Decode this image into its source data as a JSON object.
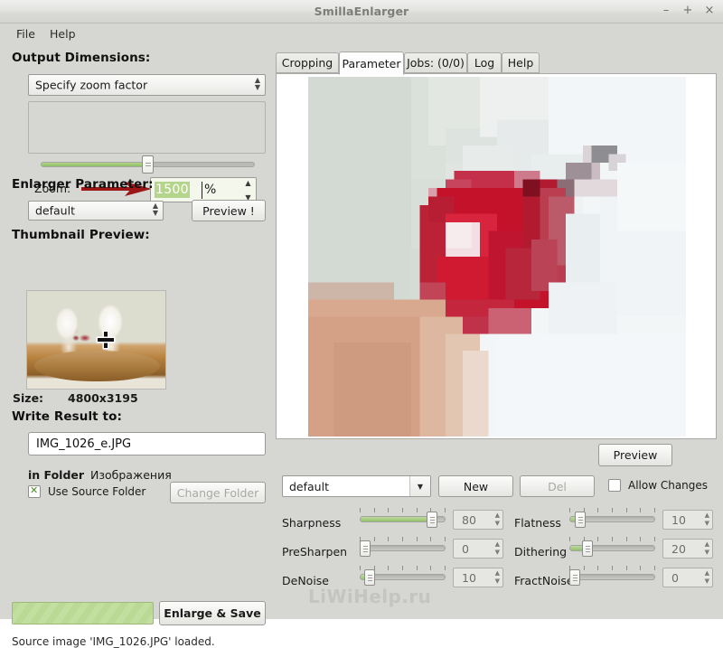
{
  "window": {
    "title": "SmillaEnlarger",
    "buttons": {
      "minimize": "–",
      "maximize": "+",
      "close": "×"
    }
  },
  "menu": {
    "file": "File",
    "help": "Help"
  },
  "left": {
    "output_dimensions_title": "Output Dimensions:",
    "dimension_mode": "Specify zoom factor",
    "zoom_label": "Zoom:",
    "zoom_value": "1500",
    "zoom_unit": "%",
    "zoom_slider_percent": 50,
    "enlarger_parameter_title": "Enlarger Parameter:",
    "enlarger_preset": "default",
    "preview_button": "Preview !",
    "thumbnail_title": "Thumbnail Preview:",
    "size_label": "Size:",
    "size_value": "4800x3195",
    "write_result_title": "Write Result to:",
    "output_filename": "IMG_1026_e.JPG",
    "in_folder_label": "in Folder",
    "in_folder_value": "Изображения",
    "use_source_folder_label": "Use Source Folder",
    "use_source_folder_checked": true,
    "change_folder_button": "Change Folder",
    "enlarge_save_button": "Enlarge & Save",
    "status_text": "Source image 'IMG_1026.JPG' loaded."
  },
  "right": {
    "tabs": [
      {
        "label": "Cropping",
        "active": false
      },
      {
        "label": "Parameter",
        "active": true
      },
      {
        "label": "Jobs: (0/0)",
        "active": false
      },
      {
        "label": "Log",
        "active": false
      },
      {
        "label": "Help",
        "active": false
      }
    ],
    "preview_button": "Preview",
    "preset_combo": "default",
    "new_button": "New",
    "del_button": "Del",
    "allow_changes_label": "Allow Changes",
    "allow_changes_checked": false,
    "parameters": [
      {
        "name": "Sharpness",
        "value": "80",
        "percent": 80
      },
      {
        "name": "Flatness",
        "value": "10",
        "percent": 10
      },
      {
        "name": "PreSharpen",
        "value": "0",
        "percent": 0
      },
      {
        "name": "Dithering",
        "value": "20",
        "percent": 20
      },
      {
        "name": "DeNoise",
        "value": "10",
        "percent": 8
      },
      {
        "name": "FractNoise",
        "value": "0",
        "percent": 0
      }
    ]
  },
  "watermark": "LiWiHelp.ru"
}
